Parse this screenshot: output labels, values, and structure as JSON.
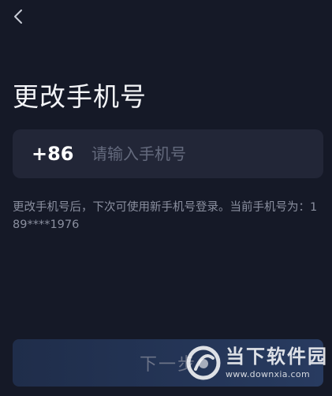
{
  "header": {
    "back_icon": "chevron-left-icon"
  },
  "page": {
    "title": "更改手机号"
  },
  "phone": {
    "country_code": "+86",
    "placeholder": "请输入手机号",
    "value": ""
  },
  "hint": {
    "text": "更改手机号后，下次可使用新手机号登录。当前手机号为：189****1976"
  },
  "actions": {
    "next_label": "下一步"
  },
  "watermark": {
    "name": "当下软件园",
    "url": "www.downxia.com"
  },
  "colors": {
    "background": "#151927",
    "input_background": "#222637",
    "placeholder": "#646a7d",
    "hint": "#8a8f9f",
    "button_disabled_text": "#6b7387"
  }
}
